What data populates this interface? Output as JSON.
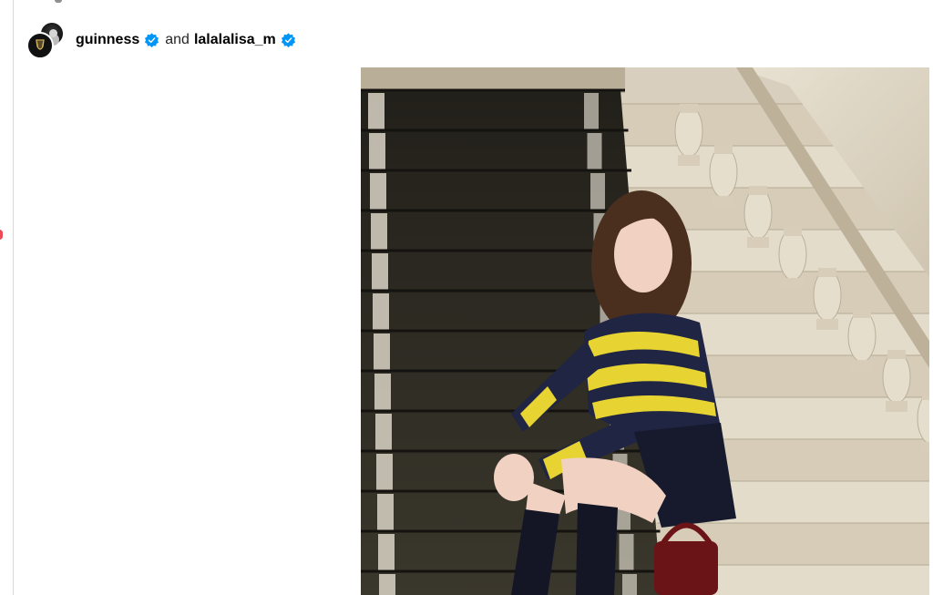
{
  "post": {
    "header": {
      "author1": "guinness",
      "conjunction": "and",
      "author2": "lalalalisa_m",
      "verified_color": "#0095f6"
    },
    "icons": {
      "author_avatar": "guinness-harp-logo",
      "coauthor_avatar": "profile-photo",
      "verified": "verified-badge-icon"
    },
    "colors": {
      "notification_dot": "#ed4956"
    }
  }
}
